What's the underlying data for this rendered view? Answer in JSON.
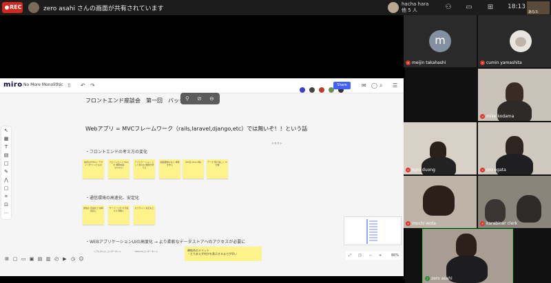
{
  "meeting": {
    "rec_label": "REC",
    "share_text": "zero asahi さんの画面が共有されています",
    "presenter_name": "hacha hara",
    "presenter_sub": "他 5 人",
    "clock": "18:13",
    "self_label": "あなた"
  },
  "miro": {
    "logo": "miro",
    "board_name": "No More Monolithic",
    "share_label": "Share",
    "title": "フロントエンド座談会　第一回　バックエンド不要論",
    "web_statement": "Webアプリ = MVCフレームワーク（rails,laravel,django,etc）では無いぞ！！という話",
    "text_label": "テキスト",
    "section1": "・フロントエンドの考え方の変化",
    "section2": "・通信環境の高速化、安定化",
    "section3": "・WEBアプリケーションUIの高度化 → より柔軟なデータストアへのアクセスが必要に",
    "stickies_row1": [
      "最初はHTMLに デザインがつ いたもの",
      "フロントエンド Webの 機能拡張 (jQuery)",
      "アプリケーション として様々な 機能が増える",
      "画面遷移のない 体験を作る",
      "SPA化 (React等)",
      "データ 受け渡しと UI分離"
    ],
    "stickies_row2": [
      "通信の 高速化で 常時接続に",
      "サーバーとの やり取りが 頻繁に",
      "オフライン 対応など"
    ],
    "big_sticky_title": "疎結合のメリット",
    "big_sticky_text": "・とりあえず何かを表示するまでが早い",
    "small_note_1": "リアルタイム コンポーネント",
    "small_note_2": "・Web(UI)コンポーネント",
    "zoom_level": "80%"
  },
  "participants": [
    {
      "name": "meijin takahashi",
      "avatar_letter": "m"
    },
    {
      "name": "cumin yamashita"
    },
    {
      "name": "mike kodama"
    },
    {
      "name": "kuro duong"
    },
    {
      "name": "oro ogata"
    },
    {
      "name": "mochi wota"
    },
    {
      "name": "karabiner clerk"
    },
    {
      "name": "zero asahi"
    }
  ],
  "colors": {
    "rec": "#d7261f",
    "sticky": "#fef38a",
    "miro_blue": "#4262ff",
    "mic_off": "#e0322b"
  }
}
